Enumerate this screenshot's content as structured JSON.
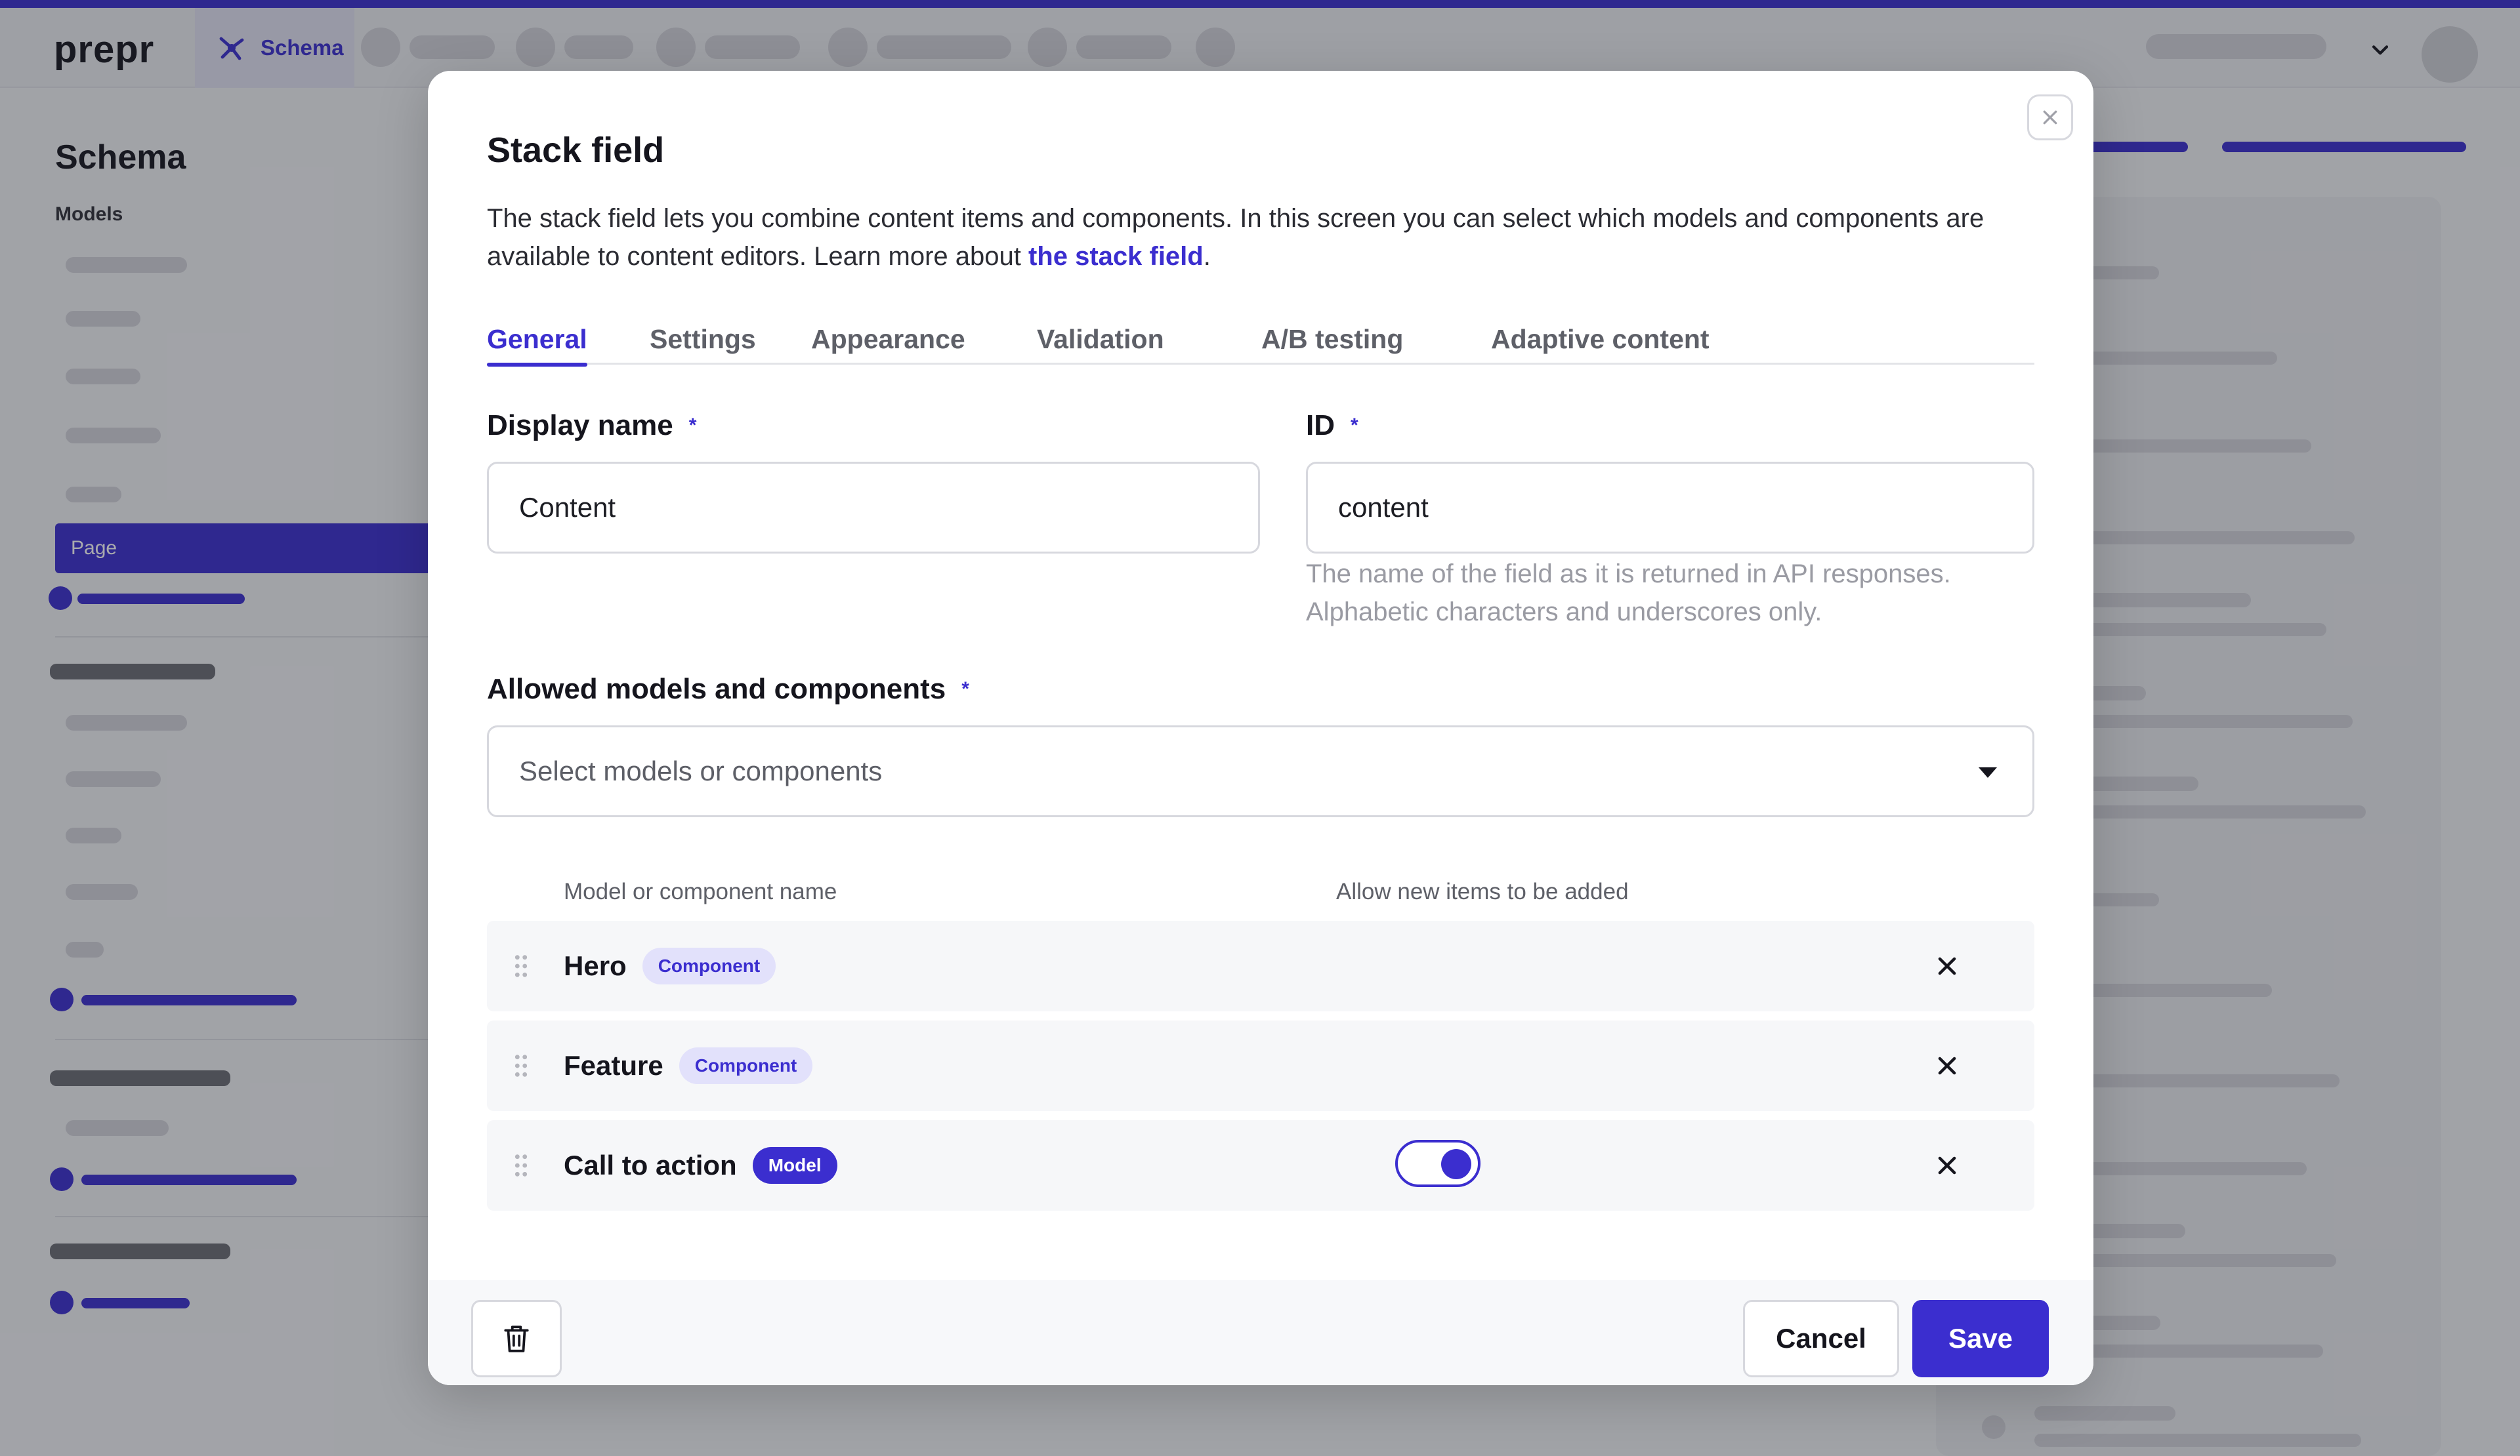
{
  "app": {
    "logo": "prepr",
    "active_tab": "Schema"
  },
  "sidebar": {
    "title": "Schema",
    "models_label": "Models",
    "selected_item": "Page"
  },
  "modal": {
    "title": "Stack field",
    "description_before": "The stack field lets you combine content items and components. In this screen you can select which models and components are available to content editors. Learn more about ",
    "description_link": "the stack field",
    "description_after": ".",
    "tabs": [
      {
        "label": "General",
        "active": true
      },
      {
        "label": "Settings",
        "active": false
      },
      {
        "label": "Appearance",
        "active": false
      },
      {
        "label": "Validation",
        "active": false
      },
      {
        "label": "A/B testing",
        "active": false
      },
      {
        "label": "Adaptive content",
        "active": false
      }
    ],
    "display_name": {
      "label": "Display name",
      "required": "*",
      "value": "Content"
    },
    "id_field": {
      "label": "ID",
      "required": "*",
      "value": "content",
      "hint": "The name of the field as it is returned in API responses. Alphabetic characters and underscores only."
    },
    "allowed": {
      "label": "Allowed models and components",
      "required": "*",
      "placeholder": "Select models or components"
    },
    "table": {
      "col_name": "Model or component name",
      "col_allow": "Allow new items to be added",
      "rows": [
        {
          "name": "Hero",
          "badge": "Component",
          "allow_new": null
        },
        {
          "name": "Feature",
          "badge": "Component",
          "allow_new": null
        },
        {
          "name": "Call to action",
          "badge": "Model",
          "allow_new": true
        }
      ]
    },
    "footer": {
      "cancel_label": "Cancel",
      "save_label": "Save"
    }
  },
  "colors": {
    "accent": "#3b2ecf",
    "overlay": "#1e1f28"
  }
}
